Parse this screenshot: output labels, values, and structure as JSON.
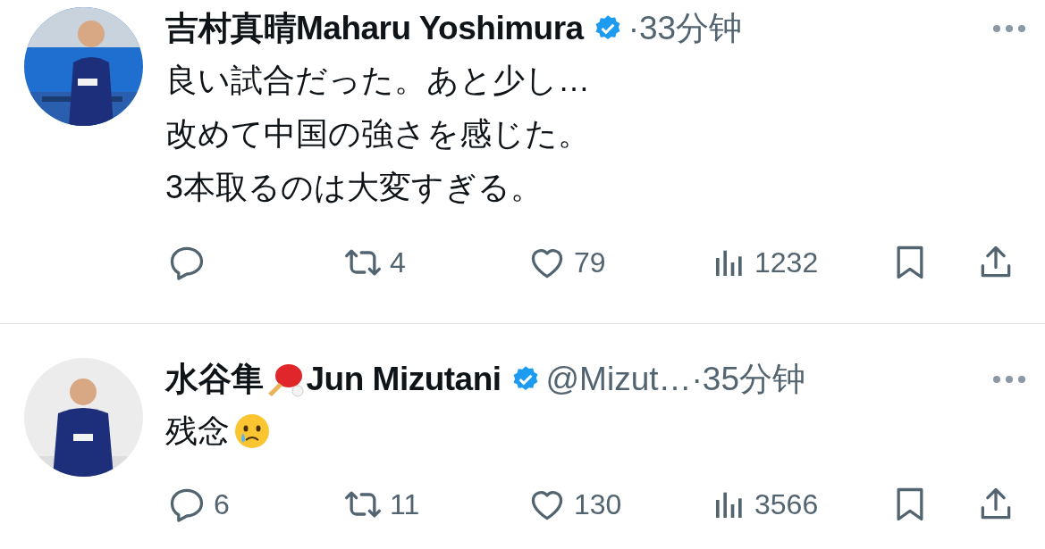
{
  "tweets": [
    {
      "display_name": "吉村真晴Maharu Yoshimura",
      "verified": true,
      "time": "·33分钟",
      "text_lines": [
        "良い試合だった。あと少し…",
        "改めて中国の強さを感じた。",
        "3本取るのは大変すぎる。"
      ],
      "avatar": {
        "kind": "picture"
      },
      "actions": [
        {
          "kind": "reply"
        },
        {
          "kind": "retweet",
          "count": "4"
        },
        {
          "kind": "like",
          "count": "79"
        },
        {
          "kind": "views",
          "count": "1232"
        },
        {
          "kind": "bookmark"
        },
        {
          "kind": "share"
        }
      ]
    },
    {
      "display_name_part1": "水谷隼",
      "display_name": "Jun Mizutani",
      "name_emoji": {
        "kind": "paddle"
      },
      "verified": true,
      "handle": "@Mizut…",
      "time": "·35分钟",
      "text_lines": [
        "残念"
      ],
      "text_emoji": {
        "kind": "crying-face"
      },
      "avatar": {
        "kind": "picture"
      },
      "actions": [
        {
          "kind": "reply",
          "count": "6"
        },
        {
          "kind": "retweet",
          "count": "11"
        },
        {
          "kind": "like",
          "count": "130"
        },
        {
          "kind": "views",
          "count": "3566"
        },
        {
          "kind": "bookmark"
        },
        {
          "kind": "share"
        }
      ]
    }
  ]
}
